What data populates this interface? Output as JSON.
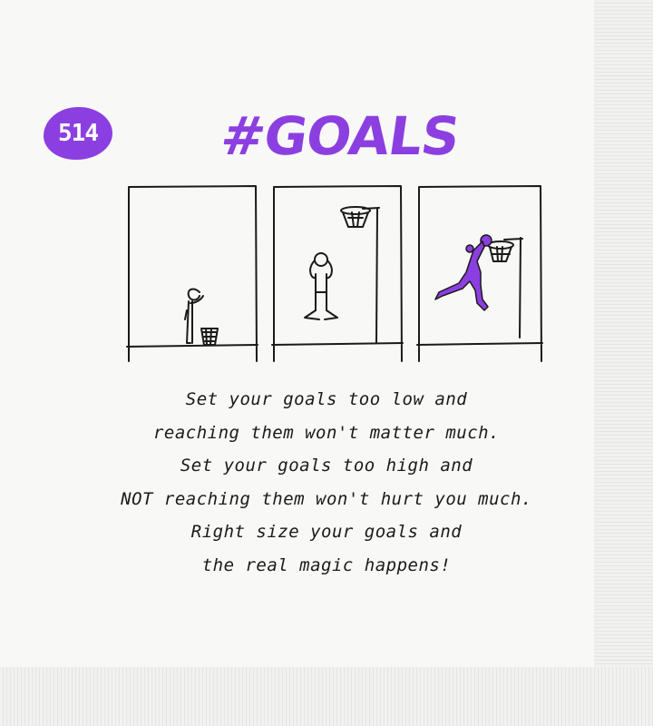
{
  "badge": {
    "number": "514"
  },
  "title": "#GOALS",
  "caption": {
    "lines": [
      "Set your goals too low and",
      "reaching them won't matter much.",
      "Set your goals too high and",
      "NOT reaching them won't hurt you much.",
      "Right size your goals and",
      "the real magic happens!"
    ]
  },
  "colors": {
    "accent": "#8c3fe0",
    "ink": "#1a1a1a",
    "paper": "#f8f8f7"
  },
  "panels": [
    {
      "scene": "figure-stooped-over-basket"
    },
    {
      "scene": "figure-looking-up-at-high-hoop"
    },
    {
      "scene": "figure-slam-dunking-at-hoop"
    }
  ]
}
